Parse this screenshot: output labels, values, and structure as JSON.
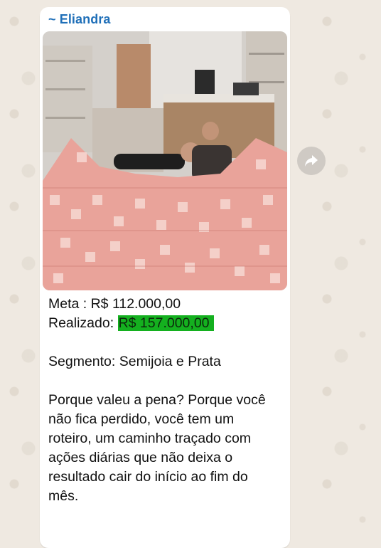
{
  "message": {
    "sender": "~ Eliandra",
    "image_alt_icon": "photo-image",
    "lines": {
      "meta": "Meta : R$ 112.000,00",
      "realizado_label": "Realizado: ",
      "realizado_value": "R$ 157.000,00",
      "segmento": "Segmento: Semijoia e Prata",
      "p1": "Porque valeu a pena? Porque você",
      "p2": "não fica perdido, você tem um",
      "p3": "roteiro, um caminho traçado com",
      "p4": "ações diárias que não deixa o",
      "p5": "resultado cair do início ao fim do",
      "p6": "mês."
    }
  },
  "actions": {
    "forward_icon": "forward-arrow-icon"
  },
  "colors": {
    "sender": "#1f6fb8",
    "highlight": "#14b01f",
    "bubble": "#ffffff",
    "wallpaper": "#efe9e1"
  }
}
